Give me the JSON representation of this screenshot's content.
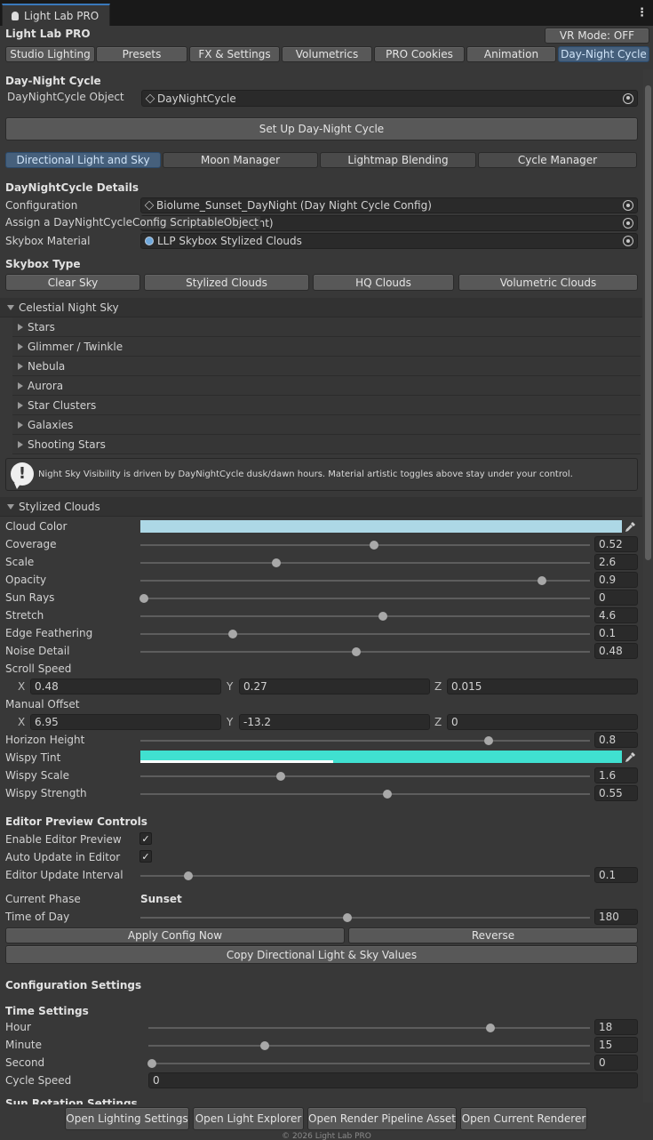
{
  "window": {
    "tab_title": "Light Lab PRO",
    "menu_icon": "kebab-menu-icon"
  },
  "header": {
    "title": "Light Lab PRO",
    "vr_mode": "VR Mode: OFF"
  },
  "main_tabs": [
    "Studio Lighting",
    "Presets",
    "FX & Settings",
    "Volumetrics",
    "PRO Cookies",
    "Animation",
    "Day-Night Cycle"
  ],
  "day_night": {
    "section_title": "Day-Night Cycle",
    "object_label": "DayNightCycle Object",
    "object_value": "DayNightCycle",
    "setup_button": "Set Up Day-Night Cycle"
  },
  "sub_tabs": [
    "Directional Light and Sky",
    "Moon Manager",
    "Lightmap Blending",
    "Cycle Manager"
  ],
  "details": {
    "title": "DayNightCycle Details",
    "config_label": "Configuration",
    "config_value": "Biolume_Sunset_DayNight (Day Night Cycle Config)",
    "assign_label": "Assign a DayNightCycleConfig ScriptableObject",
    "assign_value": "ght)",
    "skybox_label": "Skybox Material",
    "skybox_value": "LLP Skybox Stylized Clouds"
  },
  "skybox_type": {
    "title": "Skybox Type",
    "buttons": [
      "Clear Sky",
      "Stylized Clouds",
      "HQ Clouds",
      "Volumetric Clouds"
    ]
  },
  "celestial": {
    "title": "Celestial Night Sky",
    "items": [
      "Stars",
      "Glimmer / Twinkle",
      "Nebula",
      "Aurora",
      "Star Clusters",
      "Galaxies",
      "Shooting Stars"
    ],
    "help_text": "Night Sky Visibility is driven by DayNightCycle dusk/dawn hours. Material artistic toggles above stay under your control."
  },
  "clouds": {
    "title": "Stylized Clouds",
    "cloud_color_label": "Cloud Color",
    "cloud_color": "#add8e6",
    "sliders": [
      {
        "label": "Coverage",
        "value": "0.52",
        "fraction": 0.52
      },
      {
        "label": "Scale",
        "value": "2.6",
        "fraction": 0.3
      },
      {
        "label": "Opacity",
        "value": "0.9",
        "fraction": 0.9
      },
      {
        "label": "Sun Rays",
        "value": "0",
        "fraction": 0.0
      },
      {
        "label": "Stretch",
        "value": "4.6",
        "fraction": 0.54
      },
      {
        "label": "Edge Feathering",
        "value": "0.1",
        "fraction": 0.2
      },
      {
        "label": "Noise Detail",
        "value": "0.48",
        "fraction": 0.48
      }
    ],
    "scroll_speed": {
      "label": "Scroll Speed",
      "x": "0.48",
      "y": "0.27",
      "z": "0.015"
    },
    "manual_offset": {
      "label": "Manual Offset",
      "x": "6.95",
      "y": "-13.2",
      "z": "0"
    },
    "horizon": {
      "label": "Horizon Height",
      "value": "0.8",
      "fraction": 0.78
    },
    "wispy_tint_label": "Wispy Tint",
    "wispy_tint": "#40e0d0",
    "wispy_alpha_fraction": 0.4,
    "wispy_sliders": [
      {
        "label": "Wispy Scale",
        "value": "1.6",
        "fraction": 0.31
      },
      {
        "label": "Wispy Strength",
        "value": "0.55",
        "fraction": 0.55
      }
    ],
    "axis_x": "X",
    "axis_y": "Y",
    "axis_z": "Z"
  },
  "editor_preview": {
    "title": "Editor Preview Controls",
    "enable_label": "Enable Editor Preview",
    "auto_label": "Auto Update in Editor",
    "interval_label": "Editor Update Interval",
    "interval_value": "0.1",
    "interval_fraction": 0.1,
    "phase_label": "Current Phase",
    "phase_value": "Sunset",
    "time_label": "Time of Day",
    "time_value": "180",
    "time_fraction": 0.46,
    "apply_button": "Apply Config Now",
    "reverse_button": "Reverse",
    "copy_button": "Copy Directional Light & Sky Values"
  },
  "config_settings": {
    "title": "Configuration Settings",
    "time_title": "Time Settings",
    "time_sliders": [
      {
        "label": "Hour",
        "value": "18",
        "fraction": 0.78
      },
      {
        "label": "Minute",
        "value": "15",
        "fraction": 0.26
      },
      {
        "label": "Second",
        "value": "0",
        "fraction": 0.0
      }
    ],
    "cycle_speed_label": "Cycle Speed",
    "cycle_speed_value": "0",
    "cut_title": "Sun Rotation Settings"
  },
  "footer": {
    "buttons": [
      "Open Lighting Settings",
      "Open Light Explorer",
      "Open Render Pipeline Asset",
      "Open Current Renderer"
    ],
    "copyright": "© 2026 Light Lab PRO"
  },
  "colors": {
    "accent": "#3a79bb",
    "selected_tab": "#46607c",
    "panel": "#383838"
  }
}
